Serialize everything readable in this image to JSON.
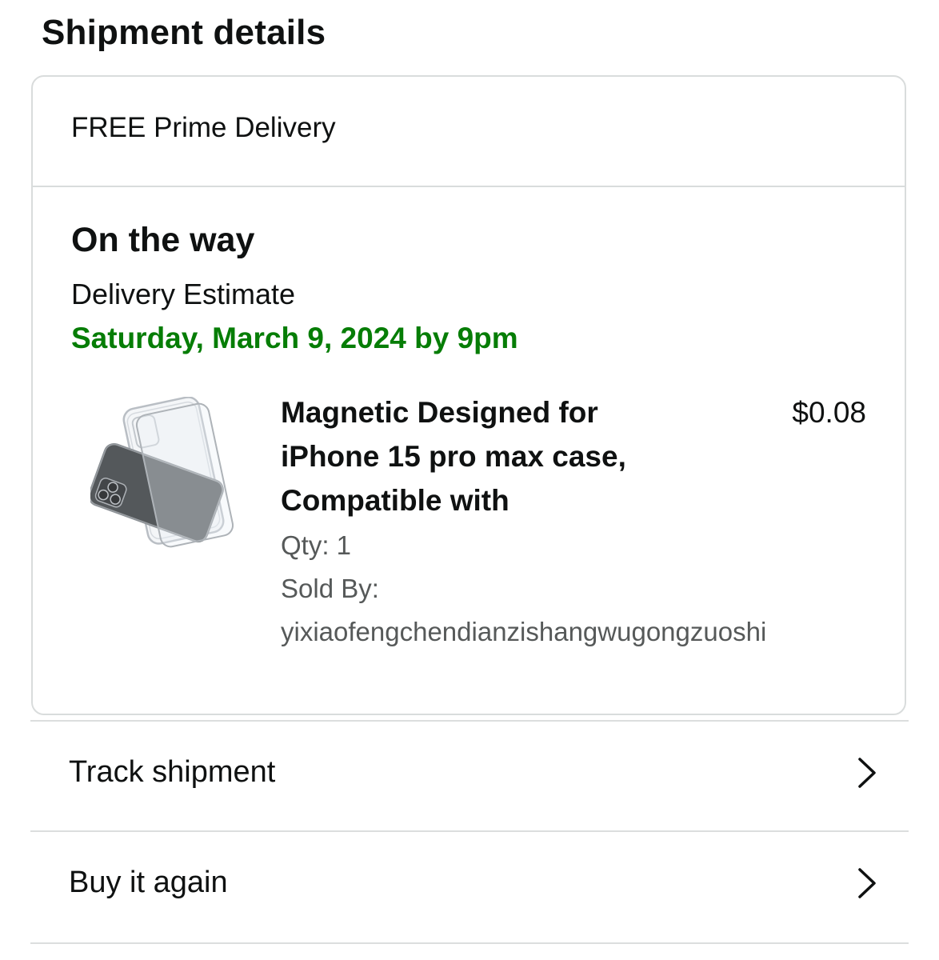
{
  "header": {
    "title": "Shipment details"
  },
  "shipment": {
    "delivery_type": "FREE Prime Delivery",
    "status": "On the way",
    "estimate_label": "Delivery Estimate",
    "estimate_date": "Saturday, March 9, 2024 by 9pm",
    "estimate_color": "#067d06"
  },
  "item": {
    "title_lines": [
      "Magnetic Designed for",
      "iPhone 15 pro max case,",
      "Compatible with"
    ],
    "price": "$0.08",
    "qty": "Qty: 1",
    "sold_by_label": "Sold By:",
    "seller": "yixiaofengchendianzishangwugongzuoshi",
    "image_icon": "phone-case-image"
  },
  "actions": {
    "track_label": "Track shipment",
    "buy_again_label": "Buy it again",
    "chevron_icon": "chevron-right-icon"
  }
}
